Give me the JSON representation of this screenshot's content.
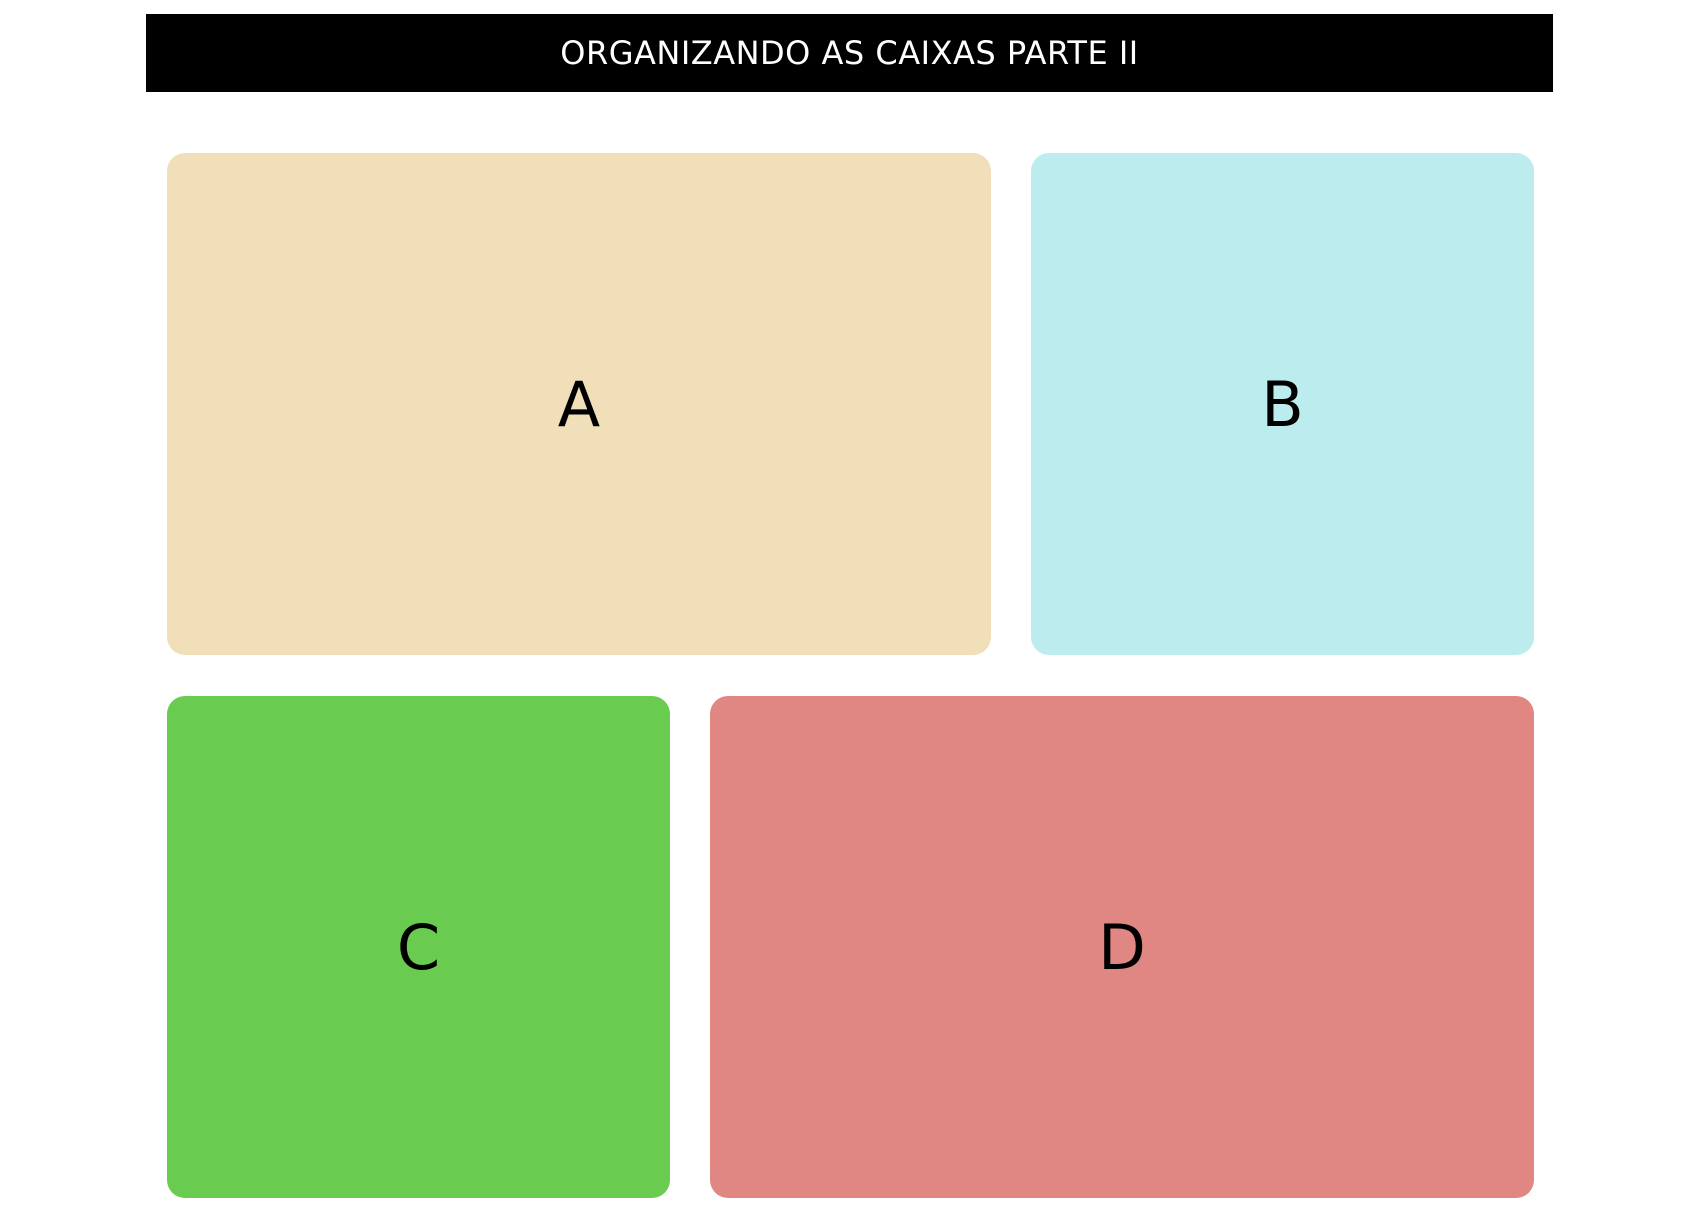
{
  "header": {
    "title": "ORGANIZANDO AS CAIXAS PARTE II"
  },
  "boxes": [
    {
      "label": "A",
      "color": "#f0dfb8"
    },
    {
      "label": "B",
      "color": "#bcecee"
    },
    {
      "label": "C",
      "color": "#69cb4f"
    },
    {
      "label": "D",
      "color": "#e08683"
    }
  ]
}
